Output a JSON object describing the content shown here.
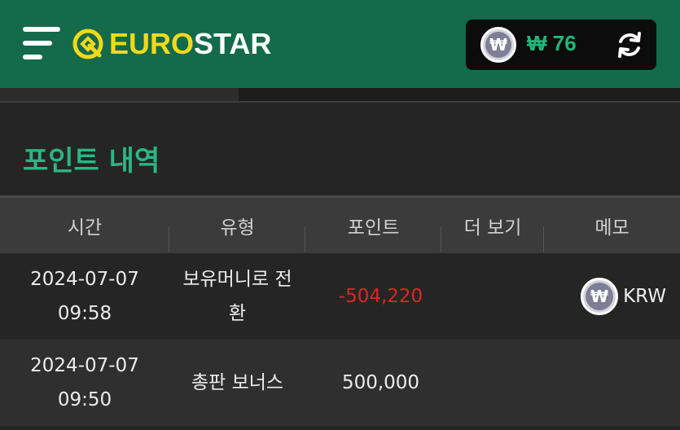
{
  "header": {
    "logo_euro": "EURO",
    "logo_star": "STAR",
    "balance_currency_symbol": "₩",
    "balance": "₩ 76"
  },
  "section": {
    "title": "포인트 내역"
  },
  "table": {
    "columns": [
      "시간",
      "유형",
      "포인트",
      "더 보기",
      "메모"
    ],
    "rows": [
      {
        "date": "2024-07-07",
        "time": "09:58",
        "type": "보유머니로 전환",
        "points": "-504,220",
        "more": "",
        "memo": "KRW"
      },
      {
        "date": "2024-07-07",
        "time": "09:50",
        "type": "총판 보너스",
        "points": "500,000",
        "more": "",
        "memo": ""
      }
    ]
  },
  "colors": {
    "header_bg": "#136b4b",
    "accent": "#2bb683",
    "logo_yellow": "#f2d81a",
    "negative": "#e0241f"
  }
}
